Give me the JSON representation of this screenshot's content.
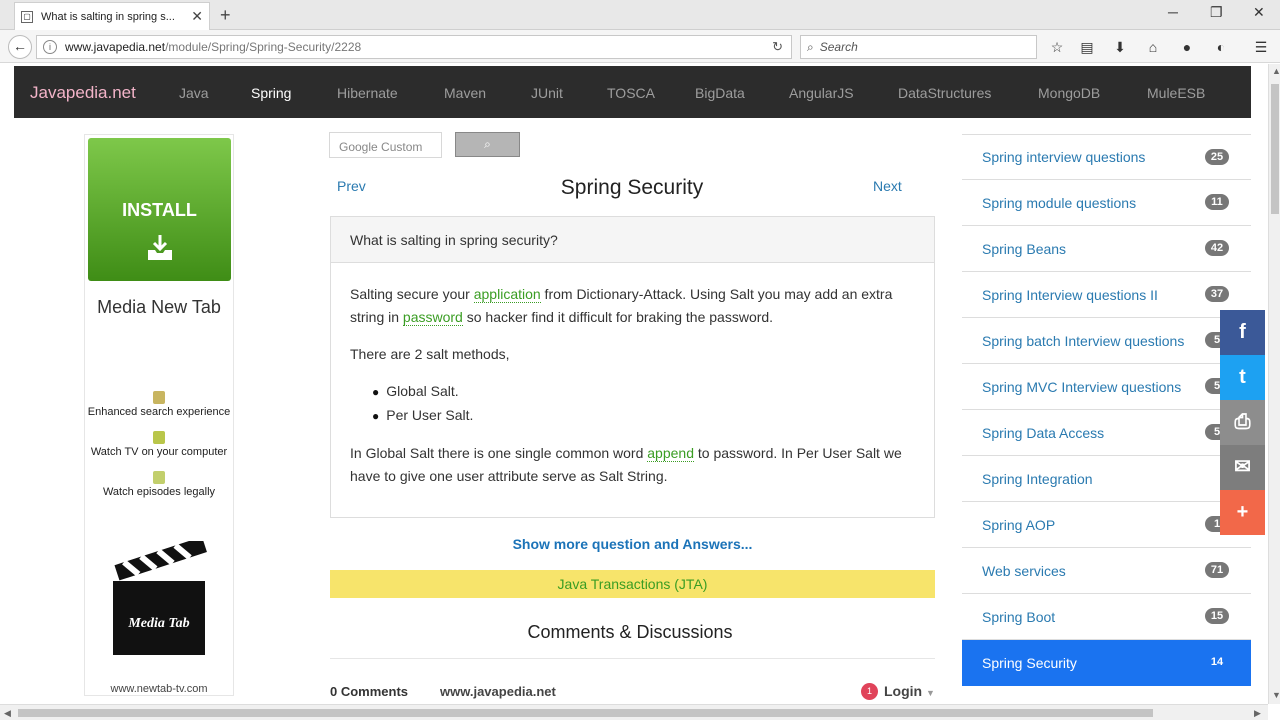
{
  "browser": {
    "tab_title": "What is salting in spring s...",
    "url_domain": "www.javapedia.net",
    "url_path": "/module/Spring/Spring-Security/2228",
    "search_placeholder": "Search"
  },
  "header": {
    "brand": "Javapedia.net",
    "menu": [
      "Java",
      "Spring",
      "Hibernate",
      "Maven",
      "JUnit",
      "TOSCA",
      "BigData",
      "AngularJS",
      "DataStructures",
      "MongoDB",
      "MuleESB"
    ],
    "active_menu": "Spring"
  },
  "ad": {
    "install_label": "INSTALL",
    "brand": "Media New Tab",
    "features": [
      "Enhanced search experience",
      "Watch TV on your computer",
      "Watch episodes legally"
    ],
    "logo_text": "Media Tab",
    "url": "www.newtab-tv.com"
  },
  "search": {
    "placeholder": "Google Custom"
  },
  "content": {
    "prev": "Prev",
    "next": "Next",
    "title": "Spring Security",
    "question": "What is salting in spring security?",
    "p1_a": "Salting secure your ",
    "p1_link1": "application",
    "p1_b": " from Dictionary-Attack. Using Salt you may add an extra string in ",
    "p1_link2": "password",
    "p1_c": " so hacker find it difficult for braking the password.",
    "p2": "There are 2 salt methods,",
    "methods": [
      "Global Salt.",
      "Per User Salt."
    ],
    "p3_a": "In Global Salt there is one single common word ",
    "p3_link": "append",
    "p3_b": " to password. In Per User Salt we have to give one user attribute serve as Salt String.",
    "more": "Show more question and Answers...",
    "jta": "Java Transactions (JTA)",
    "comments_title": "Comments & Discussions",
    "comments_count": "0 Comments",
    "comments_site": "www.javapedia.net",
    "login_badge": "1",
    "login": "Login"
  },
  "sidebar": {
    "items": [
      {
        "label": "Spring interview questions",
        "count": "25"
      },
      {
        "label": "Spring module questions",
        "count": "11"
      },
      {
        "label": "Spring Beans",
        "count": "42"
      },
      {
        "label": "Spring Interview questions II",
        "count": "37"
      },
      {
        "label": "Spring batch Interview questions",
        "count": "5"
      },
      {
        "label": "Spring MVC Interview questions",
        "count": "5"
      },
      {
        "label": "Spring Data Access",
        "count": "5"
      },
      {
        "label": "Spring Integration",
        "count": ""
      },
      {
        "label": "Spring AOP",
        "count": "1"
      },
      {
        "label": "Web services",
        "count": "71"
      },
      {
        "label": "Spring Boot",
        "count": "15"
      },
      {
        "label": "Spring Security",
        "count": "14"
      }
    ],
    "active": "Spring Security"
  },
  "colors": {
    "header_bg": "#2c2c2c",
    "brand": "#f3b4c9",
    "link_green": "#3a9d23",
    "active_blue": "#1a73f0",
    "facebook": "#3b5998",
    "twitter": "#1da1f2",
    "print": "#8d8d8d",
    "email": "#7d7d7d",
    "more": "#f26849"
  },
  "share": {
    "icons": [
      "facebook-icon",
      "twitter-icon",
      "print-icon",
      "email-icon",
      "plus-icon"
    ],
    "glyphs": [
      "f",
      "t",
      "⎙",
      "✉",
      "+"
    ]
  }
}
